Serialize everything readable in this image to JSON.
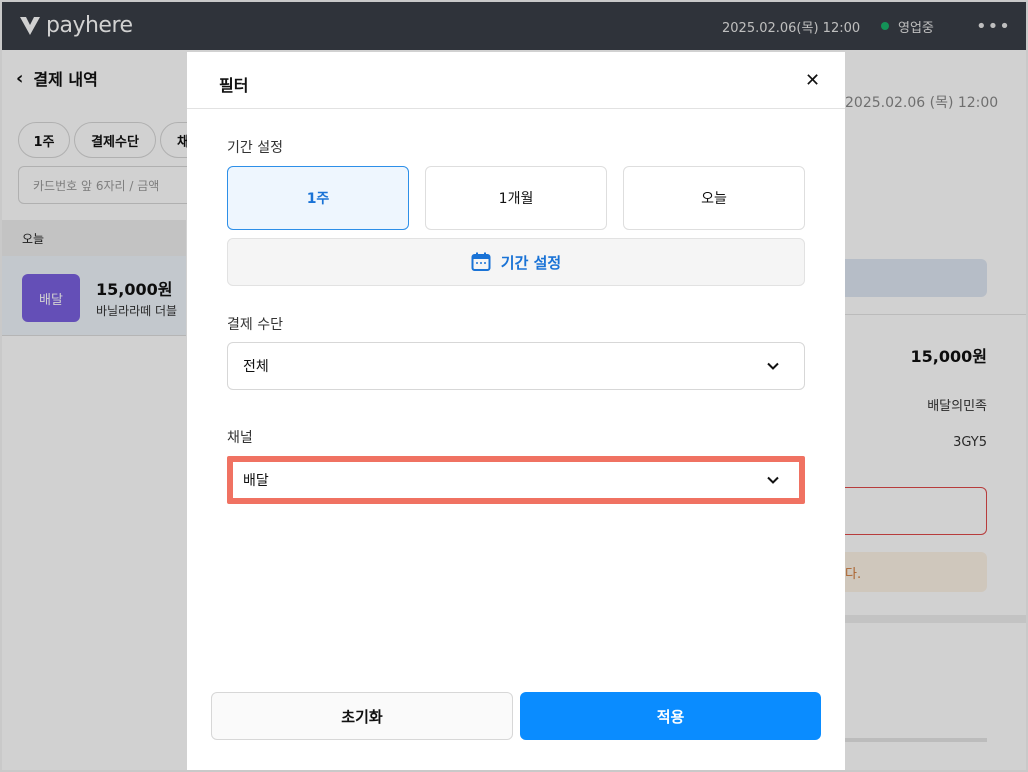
{
  "app": {
    "brand": "payhere",
    "datetime": "2025.02.06(목) 12:00",
    "status": "영업중",
    "more_icon": "more-icon"
  },
  "left": {
    "title": "결제 내역",
    "chips": [
      "1주",
      "결제수단",
      "채"
    ],
    "search_placeholder": "카드번호 앞 6자리 / 금액",
    "date_header": "오늘",
    "transaction": {
      "badge": "배달",
      "amount": "15,000원",
      "description": "바닐라라떼 더블"
    }
  },
  "right": {
    "datetime": "2025.02.06 (목) 12:00",
    "amount": "15,000원",
    "channel": "배달의민족",
    "code": "3GY5",
    "note": "다."
  },
  "modal": {
    "title": "필터",
    "period_label": "기간 설정",
    "period_options": [
      "1주",
      "1개월",
      "오늘"
    ],
    "selected_period": "1주",
    "range_button": "기간 설정",
    "payment_label": "결제 수단",
    "payment_value": "전체",
    "channel_label": "채널",
    "channel_value": "배달",
    "reset_label": "초기화",
    "apply_label": "적용"
  },
  "colors": {
    "accent": "#0a8cff",
    "highlight": "#f07262",
    "badge": "#7b61e0",
    "topbar": "#3a3f47"
  }
}
